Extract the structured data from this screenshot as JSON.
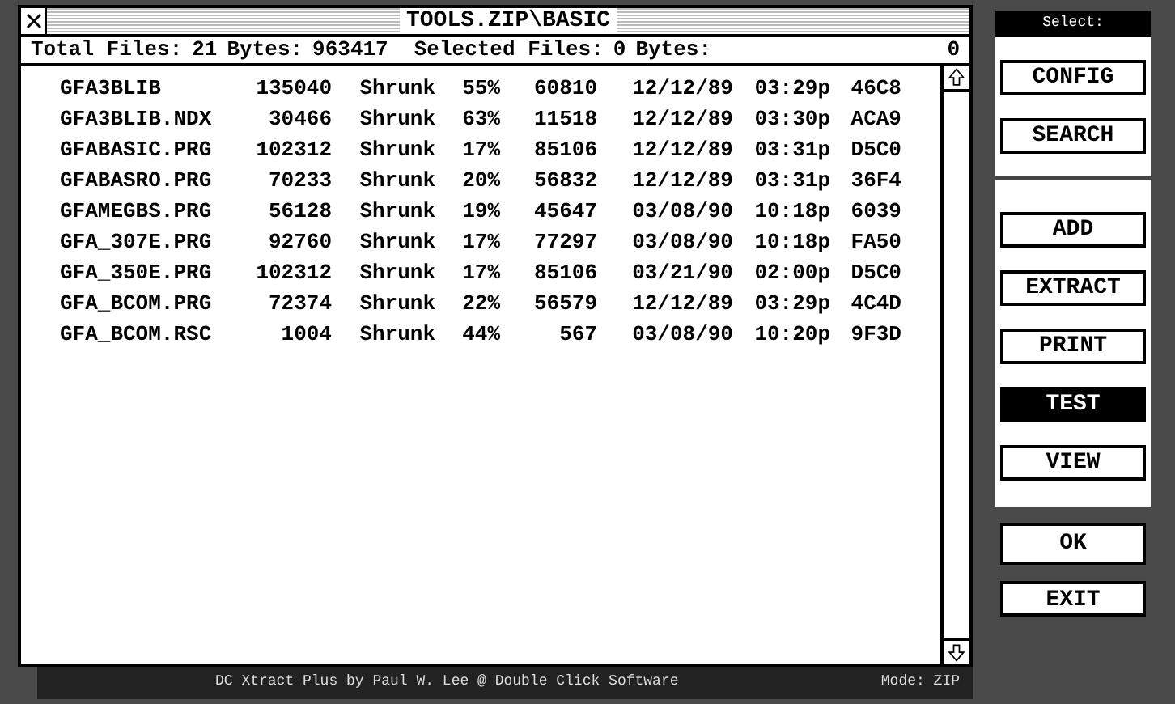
{
  "window": {
    "title": "TOOLS.ZIP\\BASIC"
  },
  "summary": {
    "total_files_label": "Total Files:",
    "total_files": "21",
    "bytes_label": "Bytes:",
    "bytes": "963417",
    "selected_files_label": "Selected Files:",
    "selected_files": "0",
    "selected_bytes_label": "Bytes:",
    "selected_bytes": "0"
  },
  "files": [
    {
      "name": "GFA3BLIB",
      "size": "135040",
      "method": "Shrunk",
      "ratio": "55%",
      "packed": "60810",
      "date": "12/12/89",
      "time": "03:29p",
      "crc": "46C8"
    },
    {
      "name": "GFA3BLIB.NDX",
      "size": "30466",
      "method": "Shrunk",
      "ratio": "63%",
      "packed": "11518",
      "date": "12/12/89",
      "time": "03:30p",
      "crc": "ACA9"
    },
    {
      "name": "GFABASIC.PRG",
      "size": "102312",
      "method": "Shrunk",
      "ratio": "17%",
      "packed": "85106",
      "date": "12/12/89",
      "time": "03:31p",
      "crc": "D5C0"
    },
    {
      "name": "GFABASRO.PRG",
      "size": "70233",
      "method": "Shrunk",
      "ratio": "20%",
      "packed": "56832",
      "date": "12/12/89",
      "time": "03:31p",
      "crc": "36F4"
    },
    {
      "name": "GFAMEGBS.PRG",
      "size": "56128",
      "method": "Shrunk",
      "ratio": "19%",
      "packed": "45647",
      "date": "03/08/90",
      "time": "10:18p",
      "crc": "6039"
    },
    {
      "name": "GFA_307E.PRG",
      "size": "92760",
      "method": "Shrunk",
      "ratio": "17%",
      "packed": "77297",
      "date": "03/08/90",
      "time": "10:18p",
      "crc": "FA50"
    },
    {
      "name": "GFA_350E.PRG",
      "size": "102312",
      "method": "Shrunk",
      "ratio": "17%",
      "packed": "85106",
      "date": "03/21/90",
      "time": "02:00p",
      "crc": "D5C0"
    },
    {
      "name": "GFA_BCOM.PRG",
      "size": "72374",
      "method": "Shrunk",
      "ratio": "22%",
      "packed": "56579",
      "date": "12/12/89",
      "time": "03:29p",
      "crc": "4C4D"
    },
    {
      "name": "GFA_BCOM.RSC",
      "size": "1004",
      "method": "Shrunk",
      "ratio": "44%",
      "packed": "567",
      "date": "03/08/90",
      "time": "10:20p",
      "crc": "9F3D"
    }
  ],
  "status_bar": {
    "credit": "DC Xtract Plus by Paul W. Lee @ Double Click Software",
    "mode": "Mode: ZIP"
  },
  "select_panel": {
    "title": "Select:",
    "groups": [
      [
        {
          "label": "CONFIG",
          "selected": false
        },
        {
          "label": "SEARCH",
          "selected": false
        }
      ],
      [
        {
          "label": "ADD",
          "selected": false
        },
        {
          "label": "EXTRACT",
          "selected": false
        },
        {
          "label": "PRINT",
          "selected": false
        },
        {
          "label": "TEST",
          "selected": true
        },
        {
          "label": "VIEW",
          "selected": false
        }
      ]
    ],
    "ok": "OK",
    "exit": "EXIT"
  }
}
